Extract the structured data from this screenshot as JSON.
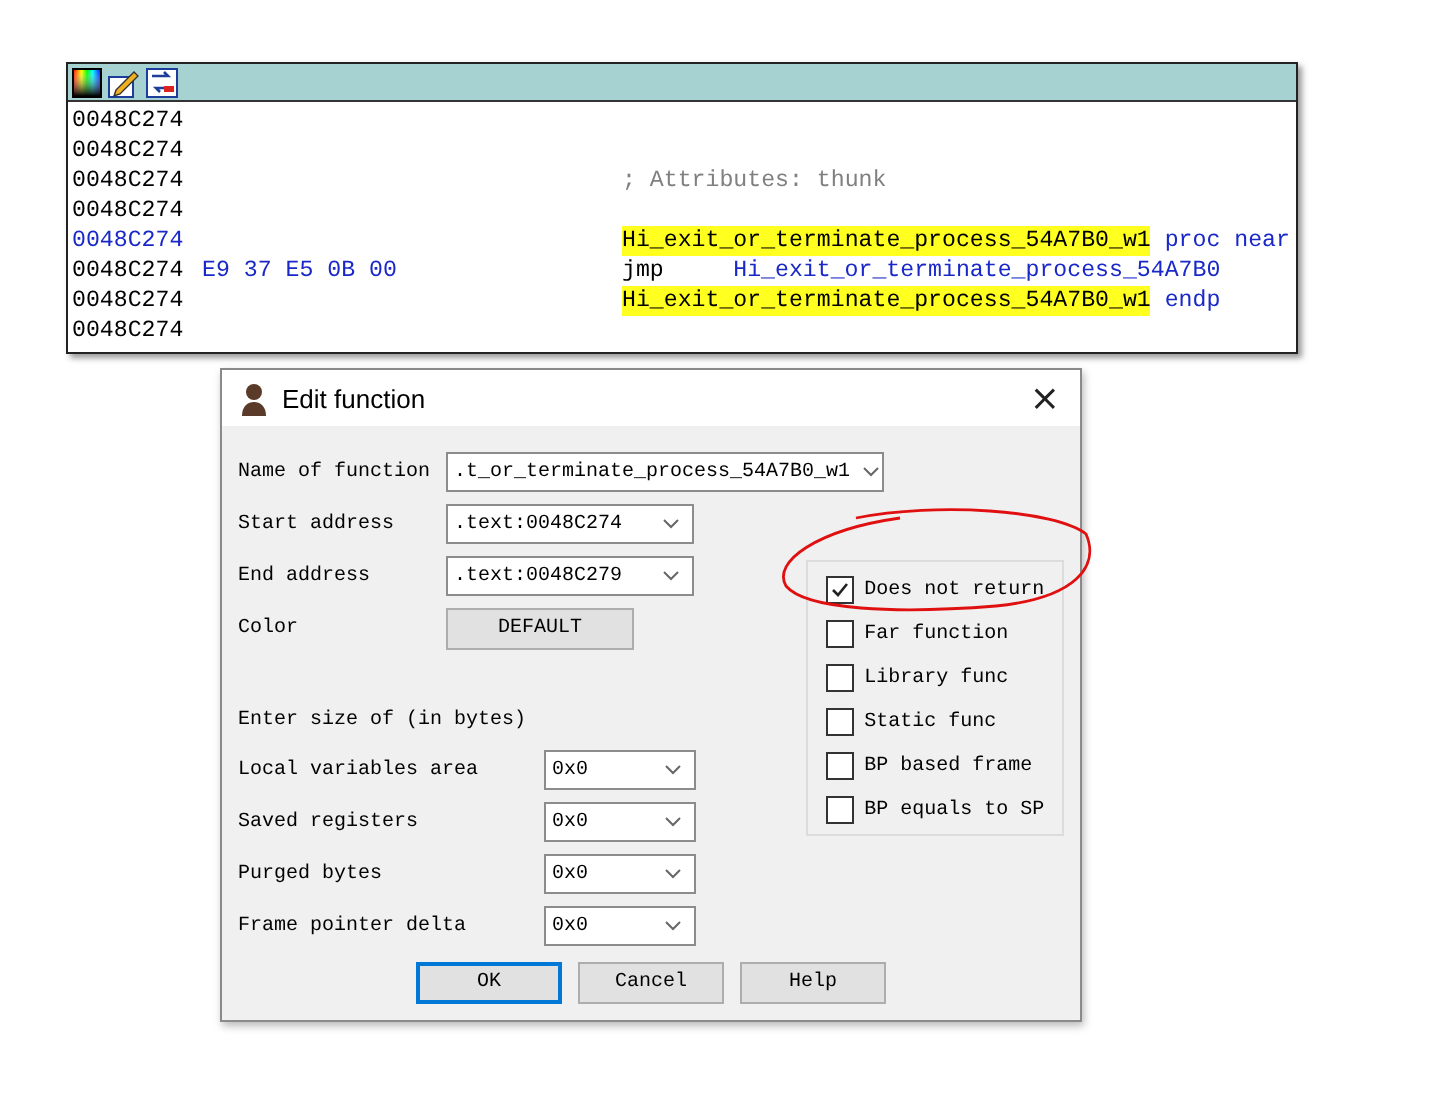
{
  "listing": [
    {
      "kind": "plain",
      "address": "0048C274"
    },
    {
      "kind": "plain",
      "address": "0048C274"
    },
    {
      "kind": "plain",
      "address": "0048C274",
      "segments": [
        {
          "kind": "comment",
          "text": "; Attributes: thunk"
        }
      ]
    },
    {
      "kind": "plain",
      "address": "0048C274"
    },
    {
      "kind": "entry",
      "address": "0048C274",
      "segments": [
        {
          "kind": "name",
          "text": "Hi_exit_or_terminate_process_54A7B0_w1"
        },
        {
          "kind": "directive",
          "text": "proc near"
        }
      ]
    },
    {
      "kind": "plain",
      "address": "0048C274",
      "bytes": "E9 37 E5 0B 00",
      "segments": [
        {
          "kind": "mnemonic",
          "text": "jmp"
        },
        {
          "kind": "operand",
          "text": "Hi_exit_or_terminate_process_54A7B0"
        }
      ]
    },
    {
      "kind": "plain",
      "address": "0048C274",
      "segments": [
        {
          "kind": "name",
          "text": "Hi_exit_or_terminate_process_54A7B0_w1"
        },
        {
          "kind": "directive",
          "text": "endp"
        }
      ]
    },
    {
      "kind": "plain",
      "address": "0048C274"
    }
  ],
  "dialog": {
    "title": "Edit function",
    "close": "×",
    "name_field": {
      "label": "Name of function",
      "value": ".t_or_terminate_process_54A7B0_w1"
    },
    "address_fields": [
      {
        "label": "Start address",
        "value": ".text:0048C274"
      },
      {
        "label": "End address",
        "value": ".text:0048C279"
      }
    ],
    "color": {
      "label": "Color",
      "button": "DEFAULT"
    },
    "size_heading": "Enter size of (in bytes)",
    "size_fields": [
      {
        "label": "Local variables area",
        "value": "0x0"
      },
      {
        "label": "Saved registers",
        "value": "0x0"
      },
      {
        "label": "Purged bytes",
        "value": "0x0"
      },
      {
        "label": "Frame pointer delta",
        "value": "0x0"
      }
    ],
    "options": [
      {
        "label": "Does not return",
        "checked": true
      },
      {
        "label": "Far function",
        "checked": false
      },
      {
        "label": "Library func",
        "checked": false
      },
      {
        "label": "Static func",
        "checked": false
      },
      {
        "label": "BP based frame",
        "checked": false
      },
      {
        "label": "BP equals to SP",
        "checked": false
      }
    ],
    "buttons": [
      {
        "label": "OK",
        "default": true
      },
      {
        "label": "Cancel",
        "default": false
      },
      {
        "label": "Help",
        "default": false
      }
    ]
  }
}
